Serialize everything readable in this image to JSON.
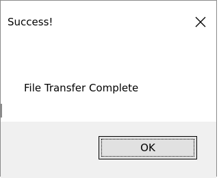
{
  "dialog": {
    "title": "Success!",
    "message": "File Transfer Complete",
    "ok_label": "OK",
    "close_icon": "close-icon"
  },
  "colors": {
    "content_background": "#ffffff",
    "button_area_background": "#f0f0f0",
    "button_face": "#e1e1e1",
    "text": "#000000",
    "border": "#8a8a8a"
  }
}
